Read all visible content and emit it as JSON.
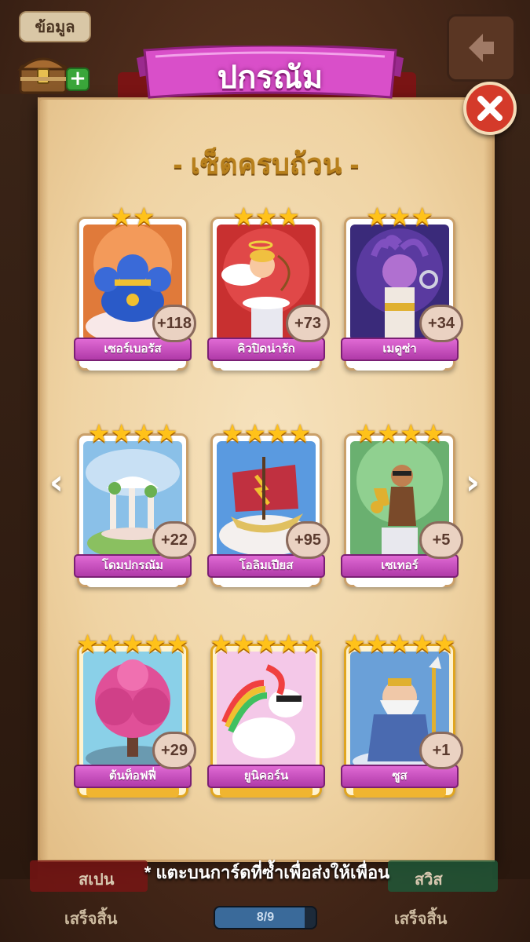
{
  "top_left_button": "ข้อมูล",
  "ribbon_title": "ปกรณัม",
  "subtitle": "- เซ็ตครบถ้วน -",
  "cards": [
    {
      "name": "เซอร์เบอรัส",
      "count": "+118",
      "stars": 2,
      "art": "cerberus"
    },
    {
      "name": "คิวปิดน่ารัก",
      "count": "+73",
      "stars": 3,
      "art": "cupid"
    },
    {
      "name": "เมดูซ่า",
      "count": "+34",
      "stars": 3,
      "art": "medusa"
    },
    {
      "name": "โดมปกรณัม",
      "count": "+22",
      "stars": 4,
      "art": "dome"
    },
    {
      "name": "โอลิมเปียส",
      "count": "+95",
      "stars": 4,
      "art": "ship"
    },
    {
      "name": "เซเทอร์",
      "count": "+5",
      "stars": 4,
      "art": "satyr"
    },
    {
      "name": "ต้นท็อฟฟี่",
      "count": "+29",
      "stars": 5,
      "art": "tree"
    },
    {
      "name": "ยูนิคอร์น",
      "count": "",
      "stars": 5,
      "art": "unicorn"
    },
    {
      "name": "ซูส",
      "count": "+1",
      "stars": 5,
      "art": "zeus"
    }
  ],
  "footer_note": "* แตะบนการ์ดที่ซ้ำเพื่อส่งให้เพื่อน",
  "footer_tab_left": "สเปน",
  "footer_tab_right": "สวิส",
  "done_left": "เสร็จสิ้น",
  "done_right": "เสร็จสิ้น",
  "progress_text": "8/9",
  "progress_fraction": 0.889,
  "icons": {
    "nav_left": "‹",
    "nav_right": "›"
  },
  "colors": {
    "ribbon": "#d94fc9",
    "card_label": "#c548bd",
    "close": "#d43a2a",
    "subtitle": "#b8801c"
  }
}
